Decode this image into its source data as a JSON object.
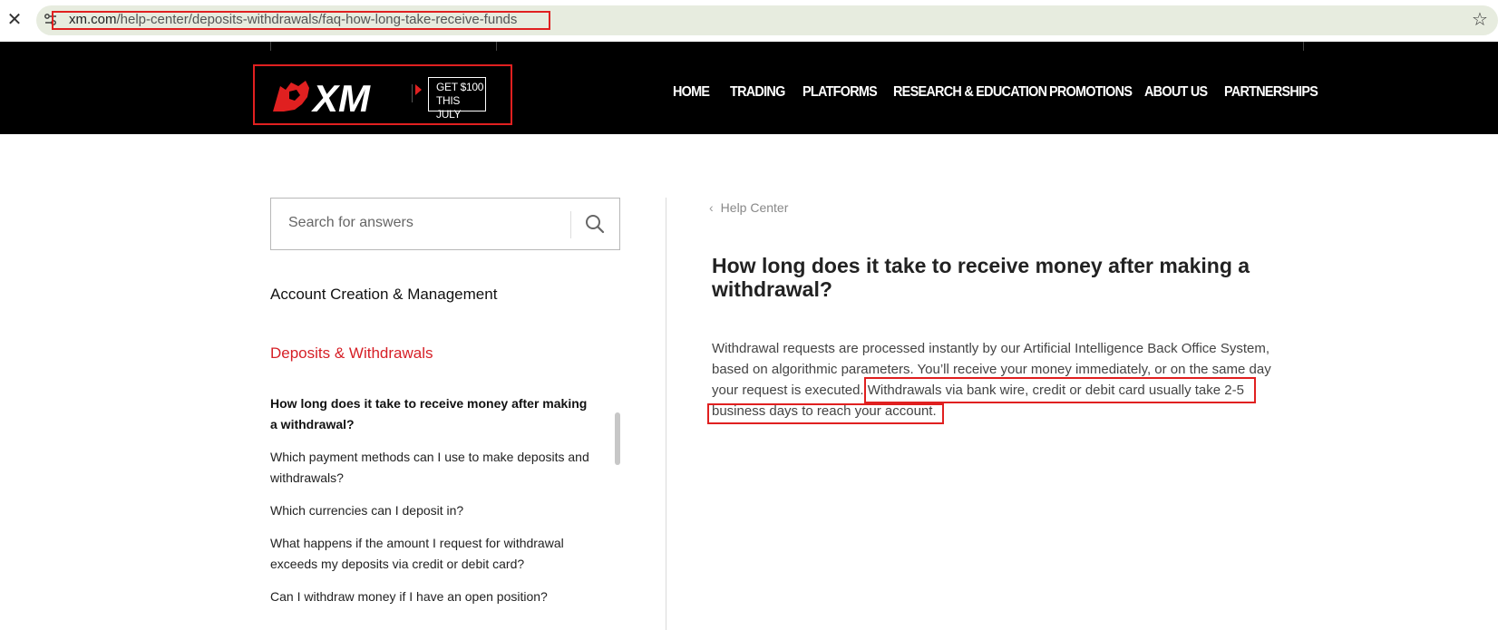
{
  "browser": {
    "url_host": "xm.com",
    "url_path": "/help-center/deposits-withdrawals/faq-how-long-take-receive-funds"
  },
  "nav": {
    "logo_text": "XM",
    "promo_line1": "GET $100",
    "promo_line2": "THIS JULY",
    "items": [
      "HOME",
      "TRADING",
      "PLATFORMS",
      "RESEARCH & EDUCATION",
      "PROMOTIONS",
      "ABOUT US",
      "PARTNERSHIPS"
    ]
  },
  "sidebar": {
    "search_placeholder": "Search for answers",
    "category_1": "Account Creation & Management",
    "category_2": "Deposits & Withdrawals",
    "faqs": [
      "How long does it take to receive money after making a withdrawal?",
      "Which payment methods can I use to make deposits and withdrawals?",
      "Which currencies can I deposit in?",
      "What happens if the amount I request for withdrawal exceeds my deposits via credit or debit card?",
      "Can I withdraw money if I have an open position?"
    ]
  },
  "content": {
    "breadcrumb": "Help Center",
    "title": "How long does it take to receive money after making a withdrawal?",
    "body": "Withdrawal requests are processed instantly by our Artificial Intelligence Back Office System, based on algorithmic parameters. You’ll receive your money immediately, or on the same day your request is executed. Withdrawals via bank wire, credit or debit card usually take 2-5 business days to reach your account."
  },
  "colors": {
    "accent_red": "#d61f26",
    "highlight_red": "#e02020",
    "nav_bg": "#000000"
  }
}
